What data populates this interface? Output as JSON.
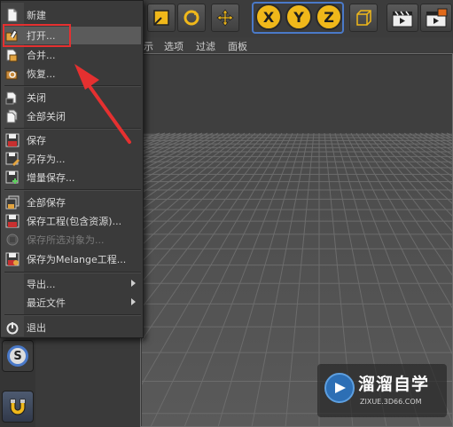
{
  "file_menu": {
    "items": [
      {
        "label": "新建",
        "icon": "new-file-icon",
        "enabled": true
      },
      {
        "label": "打开...",
        "icon": "open-file-icon",
        "enabled": true,
        "highlighted": true
      },
      {
        "label": "合并...",
        "icon": "merge-icon",
        "enabled": true
      },
      {
        "label": "恢复...",
        "icon": "revert-icon",
        "enabled": true
      },
      {
        "label": "关闭",
        "icon": "close-file-icon",
        "enabled": true
      },
      {
        "label": "全部关闭",
        "icon": "close-all-icon",
        "enabled": true
      },
      {
        "label": "保存",
        "icon": "save-icon",
        "enabled": true
      },
      {
        "label": "另存为...",
        "icon": "save-as-icon",
        "enabled": true
      },
      {
        "label": "增量保存...",
        "icon": "save-incremental-icon",
        "enabled": true
      },
      {
        "label": "全部保存",
        "icon": "save-all-icon",
        "enabled": true
      },
      {
        "label": "保存工程(包含资源)...",
        "icon": "save-project-icon",
        "enabled": true
      },
      {
        "label": "保存所选对象为...",
        "icon": "save-selected-icon",
        "enabled": false
      },
      {
        "label": "保存为Melange工程...",
        "icon": "save-melange-icon",
        "enabled": true
      },
      {
        "label": "导出...",
        "icon": "",
        "enabled": true,
        "submenu": true
      },
      {
        "label": "最近文件",
        "icon": "",
        "enabled": true,
        "submenu": true
      },
      {
        "label": "退出",
        "icon": "power-icon",
        "enabled": true
      }
    ]
  },
  "viewport_menu": {
    "items": [
      "示",
      "选项",
      "过滤",
      "面板"
    ]
  },
  "toolbar": {
    "axis_x": "X",
    "axis_y": "Y",
    "axis_z": "Z"
  },
  "left_tools": {
    "snap_label": "S"
  },
  "watermark": {
    "title": "溜溜自学",
    "url": "ZIXUE.3D66.COM"
  },
  "colors": {
    "axis_yellow": "#f0b81a",
    "annotation_red": "#e53030",
    "highlight": "#5b5b5b",
    "accent_blue": "#4a79c8"
  }
}
